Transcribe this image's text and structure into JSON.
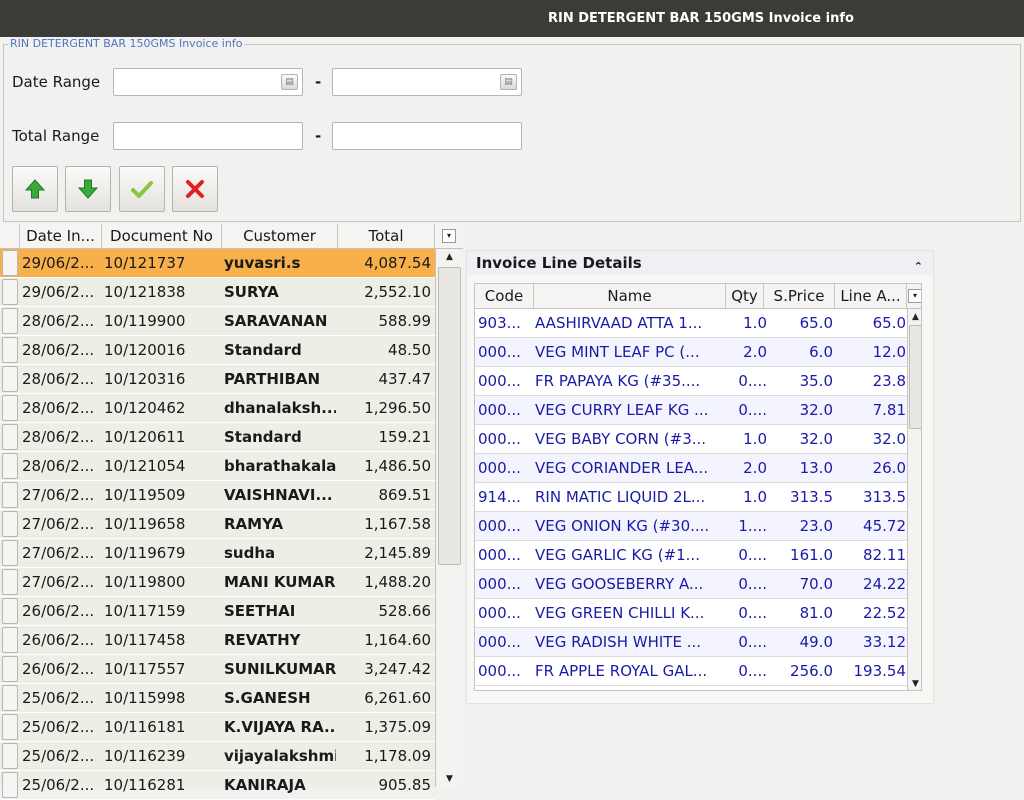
{
  "window": {
    "title": "RIN DETERGENT BAR 150GMS Invoice info"
  },
  "filter": {
    "legend": "RIN DETERGENT BAR 150GMS Invoice info",
    "date_range_label": "Date Range",
    "total_range_label": "Total Range",
    "separator": "-",
    "date_from": "",
    "date_to": "",
    "total_from": "",
    "total_to": ""
  },
  "toolbar": {
    "icons": [
      "arrow-up-icon",
      "arrow-down-icon",
      "checkmark-icon",
      "close-x-icon"
    ]
  },
  "invoices": {
    "columns": [
      "Date In...",
      "Document No",
      "Customer",
      "Total"
    ],
    "rows": [
      [
        "29/06/2...",
        "10/121737",
        "yuvasri.s",
        "4,087.54"
      ],
      [
        "29/06/2...",
        "10/121838",
        "SURYA",
        "2,552.10"
      ],
      [
        "28/06/2...",
        "10/119900",
        "SARAVANAN",
        "588.99"
      ],
      [
        "28/06/2...",
        "10/120016",
        "Standard",
        "48.50"
      ],
      [
        "28/06/2...",
        "10/120316",
        "PARTHIBAN",
        "437.47"
      ],
      [
        "28/06/2...",
        "10/120462",
        "dhanalaksh...",
        "1,296.50"
      ],
      [
        "28/06/2...",
        "10/120611",
        "Standard",
        "159.21"
      ],
      [
        "28/06/2...",
        "10/121054",
        "bharathakala",
        "1,486.50"
      ],
      [
        "27/06/2...",
        "10/119509",
        "VAISHNAVI...",
        "869.51"
      ],
      [
        "27/06/2...",
        "10/119658",
        "RAMYA",
        "1,167.58"
      ],
      [
        "27/06/2...",
        "10/119679",
        "sudha",
        "2,145.89"
      ],
      [
        "27/06/2...",
        "10/119800",
        "MANI KUMAR",
        "1,488.20"
      ],
      [
        "26/06/2...",
        "10/117159",
        "SEETHAI",
        "528.66"
      ],
      [
        "26/06/2...",
        "10/117458",
        "REVATHY",
        "1,164.60"
      ],
      [
        "26/06/2...",
        "10/117557",
        "SUNILKUMAR",
        "3,247.42"
      ],
      [
        "25/06/2...",
        "10/115998",
        "S.GANESH",
        "6,261.60"
      ],
      [
        "25/06/2...",
        "10/116181",
        "K.VIJAYA RA...",
        "1,375.09"
      ],
      [
        "25/06/2...",
        "10/116239",
        "vijayalakshmi",
        "1,178.09"
      ],
      [
        "25/06/2...",
        "10/116281",
        "KANIRAJA",
        "905.85"
      ]
    ],
    "selected_row": 0
  },
  "details": {
    "title": "Invoice Line Details",
    "columns": [
      "Code",
      "Name",
      "Qty",
      "S.Price",
      "Line A..."
    ],
    "rows": [
      [
        "903...",
        "AASHIRVAAD ATTA 1...",
        "1.0",
        "65.0",
        "65.0"
      ],
      [
        "000...",
        "VEG MINT LEAF PC  (...",
        "2.0",
        "6.0",
        "12.0"
      ],
      [
        "000...",
        "FR PAPAYA KG  (#35....",
        "0....",
        "35.0",
        "23.8"
      ],
      [
        "000...",
        "VEG CURRY LEAF KG ...",
        "0....",
        "32.0",
        "7.81"
      ],
      [
        "000...",
        "VEG BABY CORN (#3...",
        "1.0",
        "32.0",
        "32.0"
      ],
      [
        "000...",
        "VEG CORIANDER LEA...",
        "2.0",
        "13.0",
        "26.0"
      ],
      [
        "914...",
        "RIN MATIC LIQUID 2L...",
        "1.0",
        "313.5",
        "313.5"
      ],
      [
        "000...",
        "VEG ONION KG (#30....",
        "1....",
        "23.0",
        "45.72"
      ],
      [
        "000...",
        "VEG GARLIC KG   (#1...",
        "0....",
        "161.0",
        "82.11"
      ],
      [
        "000...",
        "VEG GOOSEBERRY A...",
        "0....",
        "70.0",
        "24.22"
      ],
      [
        "000...",
        "VEG GREEN CHILLI K...",
        "0....",
        "81.0",
        "22.52"
      ],
      [
        "000...",
        "VEG RADISH WHITE ...",
        "0....",
        "49.0",
        "33.12"
      ],
      [
        "000...",
        "FR APPLE ROYAL GAL...",
        "0....",
        "256.0",
        "193.54"
      ]
    ]
  },
  "colors": {
    "selected_row": "#f8b04a",
    "detail_text": "#1a1aa8",
    "legend_text": "#4a77bf",
    "titlebar": "#3c3b37"
  }
}
